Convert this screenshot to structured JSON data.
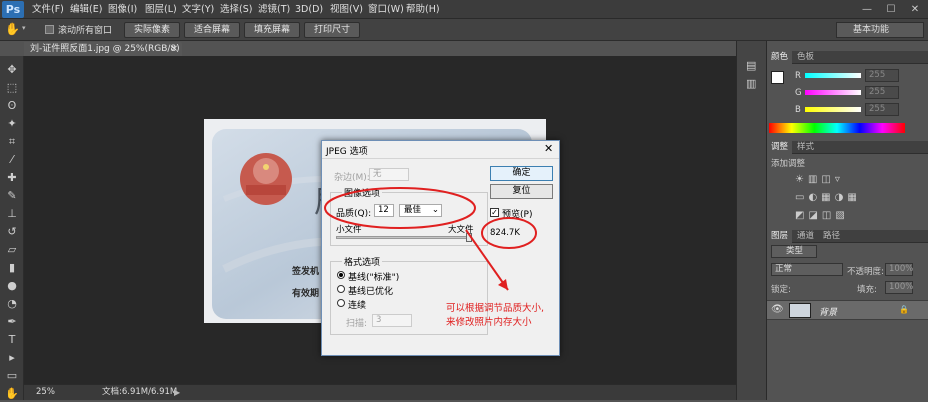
{
  "menubar": {
    "logo": "Ps",
    "items": [
      "文件(F)",
      "编辑(E)",
      "图像(I)",
      "图层(L)",
      "文字(Y)",
      "选择(S)",
      "滤镜(T)",
      "3D(D)",
      "视图(V)",
      "窗口(W)",
      "帮助(H)"
    ],
    "window_controls": [
      "—",
      "☐",
      "✕"
    ]
  },
  "options": {
    "scroll_all": "滚动所有窗口",
    "buttons": [
      "实际像素",
      "适合屏幕",
      "填充屏幕",
      "打印尺寸"
    ],
    "workspace": "基本功能"
  },
  "document": {
    "tab_title": "刘-证件照反面1.jpg @ 25%(RGB/8)",
    "card_texts": [
      "居",
      "签发机",
      "有效期"
    ]
  },
  "statusbar": {
    "zoom": "25%",
    "doc_size": "文档:6.91M/6.91M"
  },
  "dialog": {
    "title": "JPEG 选项",
    "matte_label": "杂边(M):",
    "matte_value": "无",
    "image_options_label": "图像选项",
    "quality_label": "品质(Q):",
    "quality_value": "12",
    "quality_preset": "最佳",
    "small_file": "小文件",
    "large_file": "大文件",
    "format_options_label": "格式选项",
    "format_options": [
      "基线(\"标准\")",
      "基线已优化",
      "连续"
    ],
    "scans_label": "扫描:",
    "scans_value": "3",
    "ok": "确定",
    "reset": "复位",
    "preview_label": "预览(P)",
    "file_size": "824.7K"
  },
  "annotation": {
    "text_line1": "可以根据调节品质大小,",
    "text_line2": "来修改照片内存大小",
    "color": "#e02020"
  },
  "panels": {
    "color_tabs": [
      "颜色",
      "色板"
    ],
    "channels": [
      {
        "label": "R",
        "value": "255"
      },
      {
        "label": "G",
        "value": "255"
      },
      {
        "label": "B",
        "value": "255"
      }
    ],
    "adjust_tabs": [
      "调整",
      "样式"
    ],
    "adjust_title": "添加调整",
    "layers_tabs": [
      "图层",
      "通道",
      "路径"
    ],
    "kind": "类型",
    "blend_mode": "正常",
    "opacity_label": "不透明度:",
    "opacity_value": "100%",
    "lock_label": "锁定:",
    "fill_label": "填充:",
    "fill_value": "100%",
    "layer_name": "背景"
  }
}
